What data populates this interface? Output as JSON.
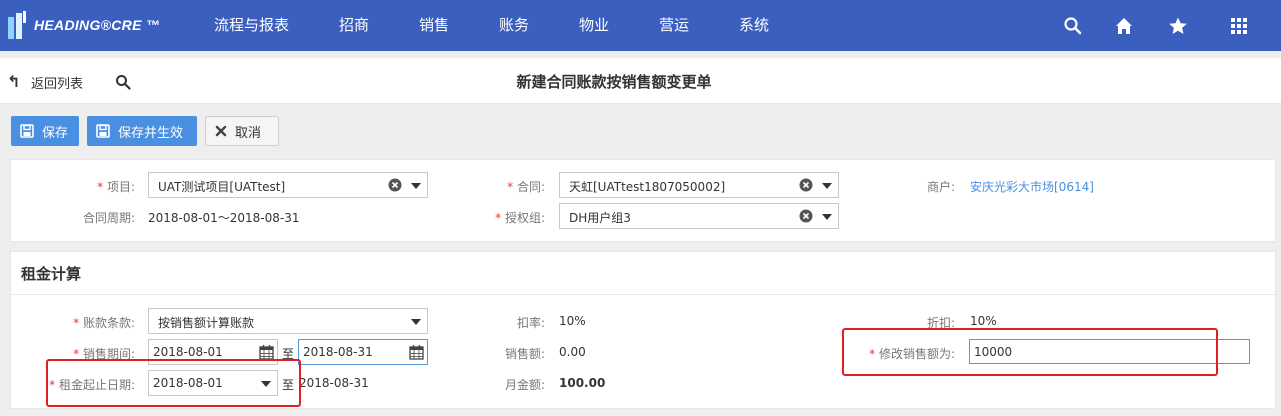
{
  "app": {
    "logo_text": "HEADING®CRE ™",
    "nav": [
      "流程与报表",
      "招商",
      "销售",
      "账务",
      "物业",
      "营运",
      "系统"
    ],
    "nav_icons": [
      "search-icon",
      "home-icon",
      "star-icon",
      "grid-icon"
    ]
  },
  "subbar": {
    "back_label": "返回列表",
    "title": "新建合同账款按销售额变更单"
  },
  "toolbar": {
    "save": "保存",
    "save_activate": "保存并生效",
    "cancel": "取消"
  },
  "panel1": {
    "project_label": "项目:",
    "project_value": "UAT测试项目[UATtest]",
    "contract_label": "合同:",
    "contract_value": "天虹[UATtest1807050002]",
    "merchant_label": "商户:",
    "merchant_value": "安庆光彩大市场[0614]",
    "period_label": "合同周期:",
    "period_value": "2018-08-01～2018-08-31",
    "auth_label": "授权组:",
    "auth_value": "DH用户组3"
  },
  "panel2": {
    "title": "租金计算",
    "terms_label": "账款条款:",
    "terms_value": "按销售额计算账款",
    "rate_label": "扣率:",
    "rate_value": "10%",
    "discount_label": "折扣:",
    "discount_value": "10%",
    "sales_period_label": "销售期间:",
    "sales_start": "2018-08-01",
    "to_1": "至",
    "sales_end": "2018-08-31",
    "sales_amount_label": "销售额:",
    "sales_amount_value": "0.00",
    "modify_label": "修改销售额为:",
    "modify_value": "10000",
    "rent_period_label": "租金起止日期:",
    "rent_start": "2018-08-01",
    "to_2": "至",
    "rent_end": "2018-08-31",
    "monthly_label": "月金额:",
    "monthly_value": "100.00"
  },
  "colors": {
    "nav_bg": "#3a5fbf",
    "primary": "#4a90e2",
    "required": "#e4393c",
    "highlight": "#e02020"
  }
}
